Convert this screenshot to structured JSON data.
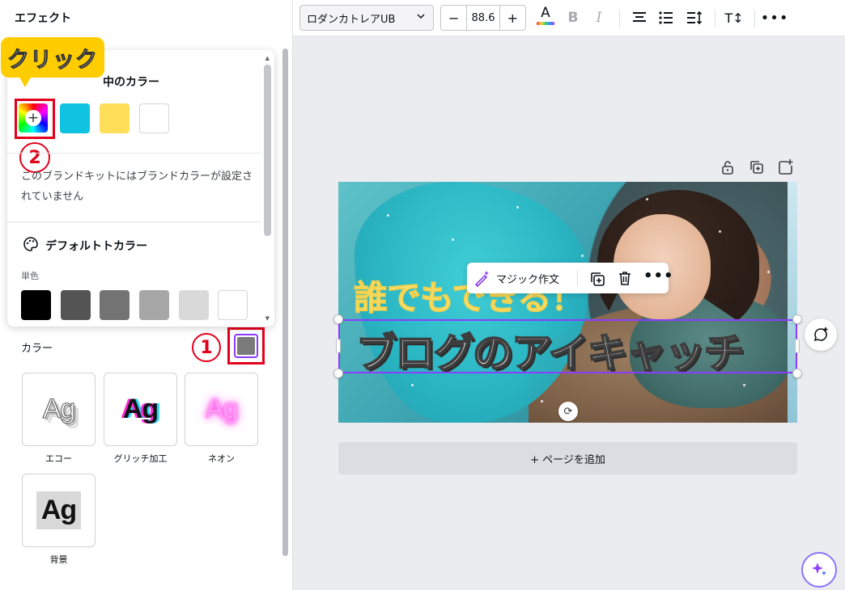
{
  "left_panel": {
    "title": "エフェクト",
    "color_label": "カラー",
    "effects": [
      {
        "name": "エコー",
        "preview": "Ag"
      },
      {
        "name": "グリッチ加工",
        "preview": "Ag"
      },
      {
        "name": "ネオン",
        "preview": "Ag"
      },
      {
        "name": "背景",
        "preview": "Ag"
      }
    ],
    "current_effect_color": "#7a7a7a"
  },
  "color_popup": {
    "doc_colors_title": "中のカラー",
    "doc_colors": [
      "#10c3e0",
      "#ffde59",
      "#ffffff"
    ],
    "add_color_symbol": "+",
    "brand_message": "このブランドキットにはブランドカラーが設定されていません",
    "default_colors_title": "デフォルトトカラー",
    "solid_label": "単色",
    "default_colors": [
      "#000000",
      "#545454",
      "#737373",
      "#a6a6a6",
      "#d9d9d9",
      "#ffffff"
    ]
  },
  "annotations": {
    "callout_text": "クリック",
    "badge_1": "1",
    "badge_2": "2",
    "highlight_color": "#e2001a"
  },
  "toolbar": {
    "font_name": "ロダンカトレアUB",
    "font_size": "88.6",
    "minus": "−",
    "plus": "+",
    "text_color_letter": "A",
    "bold": "B",
    "italic": "I",
    "case_icon": "T↕",
    "more": "•••"
  },
  "canvas": {
    "heading_sub": "誰でもできる！",
    "heading_main": "ブログのアイキャッチ",
    "floating_toolbar": {
      "magic_write": "マジック作文",
      "more": "•••"
    },
    "add_page": "+ ページを追加",
    "accent_color": "#8b3dff"
  }
}
